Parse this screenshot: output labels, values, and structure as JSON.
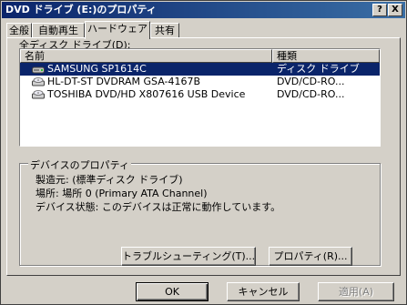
{
  "window": {
    "title": "DVD ドライブ (E:)のプロパティ",
    "help_button": "?",
    "close_button": "X"
  },
  "tabs": [
    {
      "label": "全般",
      "active": false
    },
    {
      "label": "自動再生",
      "active": false
    },
    {
      "label": "ハードウェア",
      "active": true
    },
    {
      "label": "共有",
      "active": false
    }
  ],
  "drives": {
    "label": "全ディスク ドライブ(D):",
    "columns": {
      "name": "名前",
      "type": "種類"
    },
    "rows": [
      {
        "name": "SAMSUNG SP1614C",
        "type": "ディスク ドライブ",
        "selected": true,
        "icon": "hard-disk-icon"
      },
      {
        "name": "HL-DT-ST DVDRAM GSA-4167B",
        "type": "DVD/CD-RO...",
        "selected": false,
        "icon": "optical-drive-icon"
      },
      {
        "name": "TOSHIBA DVD/HD  X807616 USB Device",
        "type": "DVD/CD-RO...",
        "selected": false,
        "icon": "optical-drive-icon"
      }
    ]
  },
  "device_properties": {
    "group_title": "デバイスのプロパティ",
    "manufacturer": "製造元: (標準ディスク ドライブ)",
    "location": "場所: 場所 0 (Primary ATA Channel)",
    "status": "デバイス状態: このデバイスは正常に動作しています。",
    "troubleshoot_button": "トラブルシューティング(T)...",
    "properties_button": "プロパティ(R)..."
  },
  "footer": {
    "ok": "OK",
    "cancel": "キャンセル",
    "apply": "適用(A)"
  },
  "colors": {
    "titlebar": "#0a246a",
    "selection": "#0a246a",
    "face": "#d4d0c8"
  }
}
